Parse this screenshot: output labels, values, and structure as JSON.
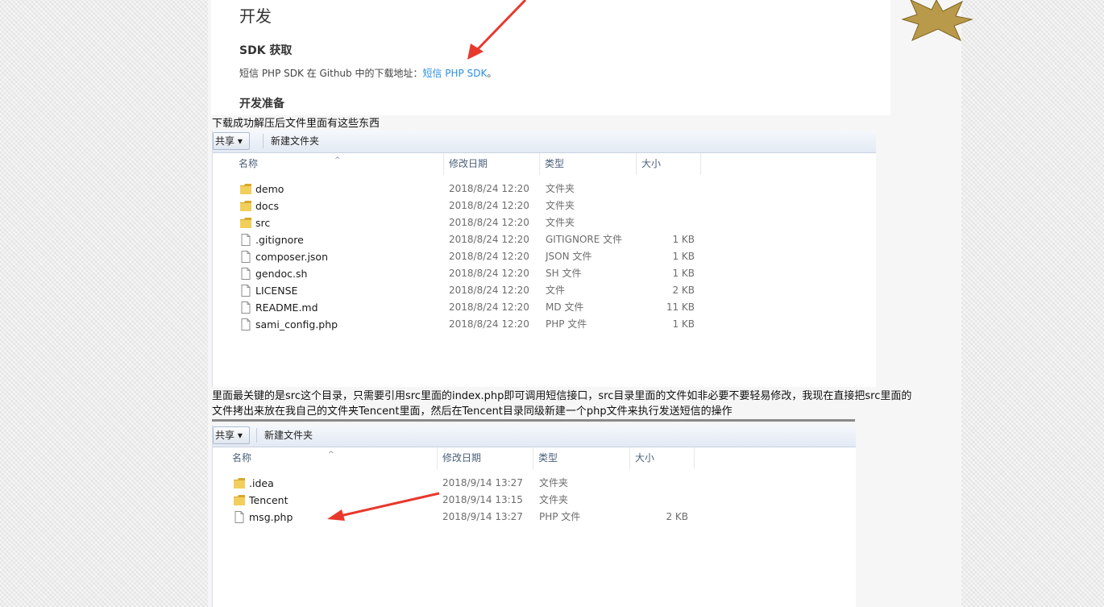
{
  "doc": {
    "title": "开发",
    "sdk_heading": "SDK 获取",
    "sdk_text": "短信 PHP SDK 在 Github 中的下载地址：",
    "sdk_link": "短信 PHP SDK",
    "sdk_end": "。",
    "prep_heading": "开发准备"
  },
  "caption1": "下载成功解压后文件里面有这些东西",
  "caption2_line1": "里面最关键的是src这个目录，只需要引用src里面的index.php即可调用短信接口，src目录里面的文件如非必要不要轻易修改，我现在直接把src里面的",
  "caption2_line2": "文件拷出来放在我自己的文件夹Tencent里面，然后在Tencent目录同级新建一个php文件来执行发送短信的操作",
  "explorer1": {
    "share_label": "共享 ▾",
    "new_folder_label": "新建文件夹",
    "columns": {
      "name": "名称",
      "date": "修改日期",
      "type": "类型",
      "size": "大小"
    },
    "rows": [
      {
        "icon": "folder-icon",
        "name": "demo",
        "date": "2018/8/24 12:20",
        "type": "文件夹",
        "size": ""
      },
      {
        "icon": "folder-icon",
        "name": "docs",
        "date": "2018/8/24 12:20",
        "type": "文件夹",
        "size": ""
      },
      {
        "icon": "folder-icon",
        "name": "src",
        "date": "2018/8/24 12:20",
        "type": "文件夹",
        "size": ""
      },
      {
        "icon": "file-icon",
        "name": ".gitignore",
        "date": "2018/8/24 12:20",
        "type": "GITIGNORE 文件",
        "size": "1 KB"
      },
      {
        "icon": "file-icon",
        "name": "composer.json",
        "date": "2018/8/24 12:20",
        "type": "JSON 文件",
        "size": "1 KB"
      },
      {
        "icon": "file-icon",
        "name": "gendoc.sh",
        "date": "2018/8/24 12:20",
        "type": "SH 文件",
        "size": "1 KB"
      },
      {
        "icon": "file-icon",
        "name": "LICENSE",
        "date": "2018/8/24 12:20",
        "type": "文件",
        "size": "2 KB"
      },
      {
        "icon": "file-icon",
        "name": "README.md",
        "date": "2018/8/24 12:20",
        "type": "MD 文件",
        "size": "11 KB"
      },
      {
        "icon": "file-icon",
        "name": "sami_config.php",
        "date": "2018/8/24 12:20",
        "type": "PHP 文件",
        "size": "1 KB"
      }
    ]
  },
  "explorer2": {
    "share_label": "共享 ▾",
    "new_folder_label": "新建文件夹",
    "columns": {
      "name": "名称",
      "date": "修改日期",
      "type": "类型",
      "size": "大小"
    },
    "rows": [
      {
        "icon": "folder-icon",
        "name": ".idea",
        "date": "2018/9/14 13:27",
        "type": "文件夹",
        "size": ""
      },
      {
        "icon": "folder-icon",
        "name": "Tencent",
        "date": "2018/9/14 13:15",
        "type": "文件夹",
        "size": ""
      },
      {
        "icon": "file-icon",
        "name": "msg.php",
        "date": "2018/9/14 13:27",
        "type": "PHP 文件",
        "size": "2 KB"
      }
    ]
  },
  "colors": {
    "arrow": "#e8382c",
    "link": "#2a8fdf",
    "folder": "#e8c24a"
  }
}
